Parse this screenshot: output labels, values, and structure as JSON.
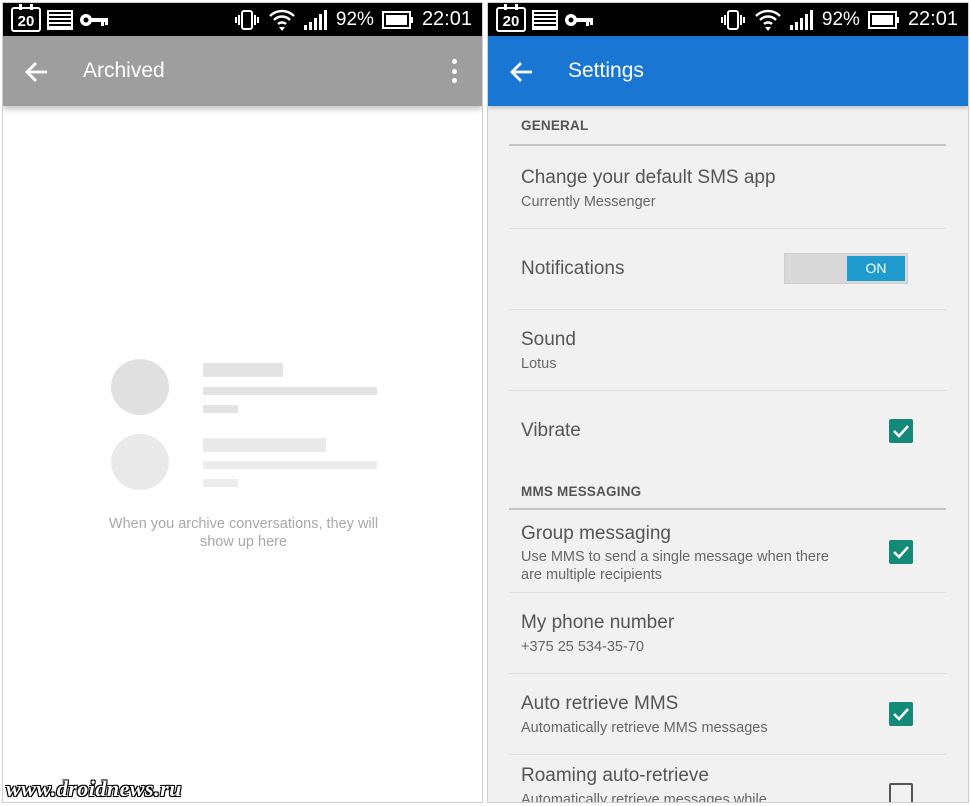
{
  "status_bar": {
    "calendar_day": "20",
    "battery_percent": "92%",
    "time": "22:01",
    "icons": [
      "calendar-icon",
      "image-notification-icon",
      "vpn-key-icon",
      "vibrate-icon",
      "wifi-icon",
      "signal-icon",
      "battery-icon"
    ]
  },
  "archived_screen": {
    "title": "Archived",
    "toolbar_color": "#9e9e9e",
    "empty_message_line1": "When you archive conversations, they will",
    "empty_message_line2": "show up here",
    "placeholder_color": "#e3e3e3"
  },
  "settings_screen": {
    "title": "Settings",
    "toolbar_color": "#1976d2",
    "accent_color": "#128a77",
    "sections": {
      "general": "GENERAL",
      "mms": "MMS MESSAGING"
    },
    "items": {
      "default_sms": {
        "title": "Change your default SMS app",
        "summary": "Currently Messenger"
      },
      "notifications": {
        "title": "Notifications",
        "toggle_label": "ON",
        "enabled": true
      },
      "sound": {
        "title": "Sound",
        "summary": "Lotus"
      },
      "vibrate": {
        "title": "Vibrate",
        "checked": true
      },
      "group_messaging": {
        "title": "Group messaging",
        "summary_line1": "Use MMS to send a single message when there",
        "summary_line2": "are multiple recipients",
        "checked": true
      },
      "phone_number": {
        "title": "My phone number",
        "summary": "+375 25 534-35-70"
      },
      "auto_retrieve": {
        "title": "Auto retrieve MMS",
        "summary": "Automatically retrieve MMS messages",
        "checked": true
      },
      "roaming": {
        "title": "Roaming auto-retrieve",
        "summary": "Automatically retrieve messages while",
        "checked": false
      }
    }
  },
  "watermark": "www.droidnews.ru"
}
